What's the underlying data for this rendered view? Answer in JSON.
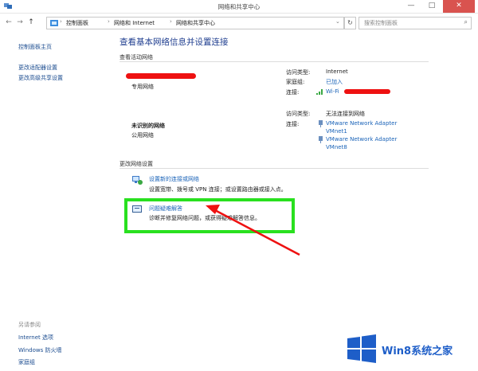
{
  "window": {
    "title": "网络和共享中心",
    "controls": {
      "minimize": "—",
      "maximize": "□",
      "close": "✕"
    }
  },
  "address": {
    "nav": {
      "back": "←",
      "forward": "→",
      "up": "↑"
    },
    "crumbs": [
      "控制面板",
      "网络和 Internet",
      "网络和共享中心"
    ],
    "separator": "›",
    "refresh": "↻",
    "dropdown": "⌄",
    "search_placeholder": "搜索控制面板"
  },
  "sidebar": {
    "links": [
      "控制面板主页",
      "更改适配器设置",
      "更改高级共享设置"
    ],
    "see_also_title": "另请参阅",
    "see_also": [
      "Internet 选项",
      "Windows 防火墙",
      "家庭组"
    ]
  },
  "main": {
    "title": "查看基本网络信息并设置连接",
    "active_networks_title": "查看活动网络",
    "network1": {
      "type": "专用网络",
      "labels": {
        "access": "访问类型:",
        "homegroup": "家庭组:",
        "connection": "连接:"
      },
      "access_value": "Internet",
      "homegroup_value": "已加入",
      "connection_value": "Wi-Fi"
    },
    "network2": {
      "name": "未识别的网络",
      "type": "公用网络",
      "labels": {
        "access": "访问类型:",
        "connection": "连接:"
      },
      "access_value": "无法连接到网络",
      "adapters": [
        "VMware Network Adapter",
        "VMnet1",
        "VMware Network Adapter",
        "VMnet8"
      ]
    },
    "change_settings_title": "更改网络设置",
    "tasks": [
      {
        "link": "设置新的连接或网络",
        "desc": "设置宽带、拨号或 VPN 连接；或设置路由器或接入点。"
      },
      {
        "link": "问题疑难解答",
        "desc": "诊断并修复网络问题，或获得疑难解答信息。"
      }
    ]
  },
  "watermark": {
    "text": "Win8系统之家"
  },
  "colors": {
    "accent_link": "#1a63b8",
    "title_blue": "#1e3d8f",
    "highlight_green": "#29e01f",
    "annotation_red": "#ee1111",
    "close_red": "#d9534f"
  }
}
